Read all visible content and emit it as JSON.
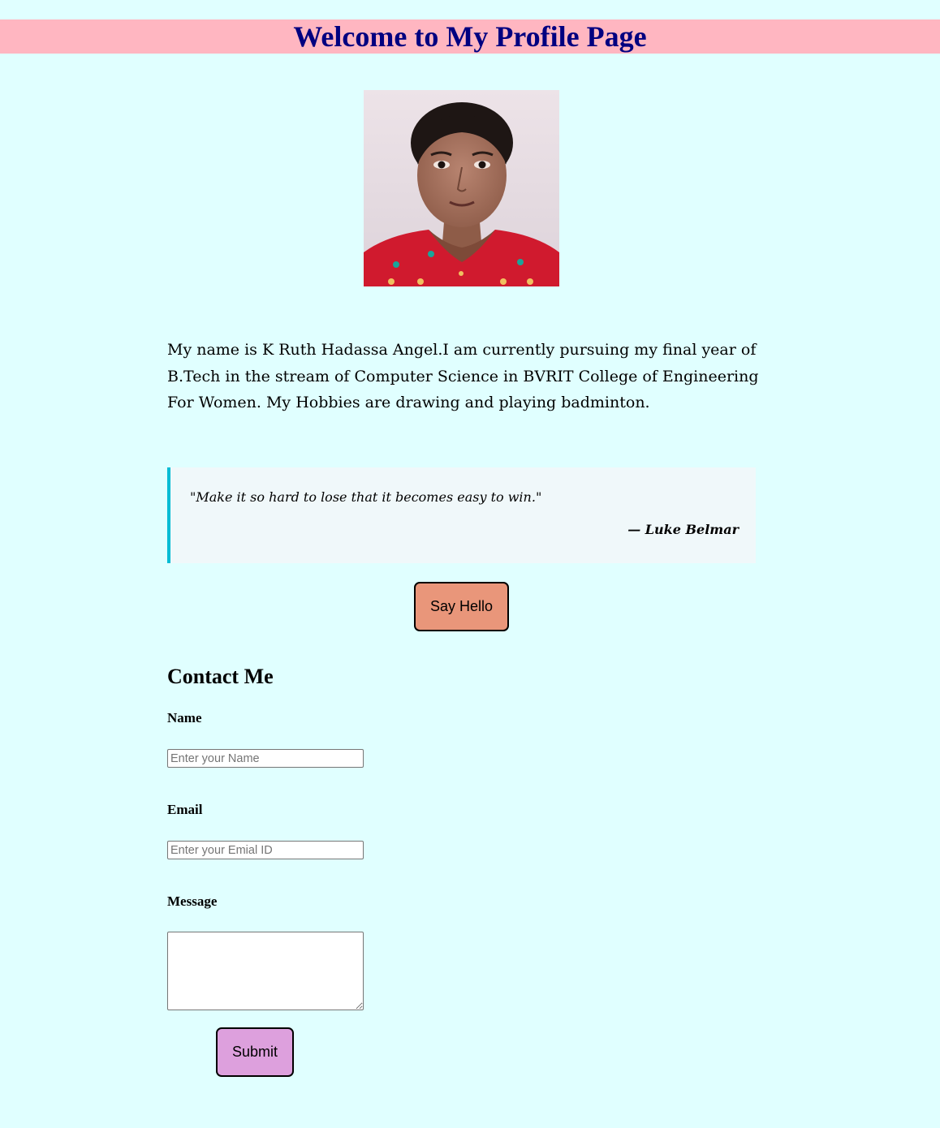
{
  "header": {
    "title": "Welcome to My Profile Page"
  },
  "profile": {
    "photo_icon": "profile-photo"
  },
  "bio": {
    "text": "My name is K Ruth Hadassa Angel.I am currently pursuing my final year of B.Tech in the stream of Computer Science in BVRIT College of Engineering For Women. My Hobbies are drawing and playing badminton."
  },
  "quote": {
    "text": "\"Make it so hard to lose that it becomes easy to win.\"",
    "author": "— Luke Belmar"
  },
  "hello_button": {
    "label": "Say Hello"
  },
  "contact": {
    "title": "Contact Me",
    "name_label": "Name",
    "name_placeholder": "Enter your Name",
    "email_label": "Email",
    "email_placeholder": "Enter your Emial ID",
    "message_label": "Message",
    "submit_label": "Submit"
  },
  "colors": {
    "page_background": "#e0ffff",
    "header_background": "#ffb6c1",
    "title_color": "#000080",
    "quote_background": "#f0f8fa",
    "quote_border": "#00bcd4",
    "hello_button": "#e9967a",
    "submit_button": "#dda0dd"
  }
}
